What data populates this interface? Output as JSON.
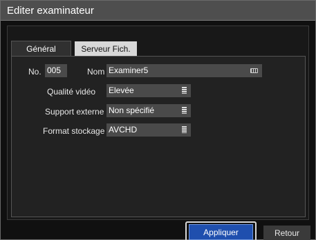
{
  "window": {
    "title": "Editer examinateur"
  },
  "tabs": {
    "general": "Général",
    "server": "Serveur Fich."
  },
  "fields": {
    "no_label": "No.",
    "no_value": "005",
    "name_label": "Nom",
    "name_value": "Examiner5",
    "video_quality_label": "Qualité vidéo",
    "video_quality_value": "Elevée",
    "external_support_label": "Support externe",
    "external_support_value": "Non spécifié",
    "storage_format_label": "Format stockage",
    "storage_format_value": "AVCHD"
  },
  "buttons": {
    "apply": "Appliquer",
    "back": "Retour"
  },
  "icons": {
    "keyboard": "keyboard-icon",
    "dropdown": "list-icon"
  },
  "colors": {
    "accent": "#1f4fae",
    "field_bg": "#4a4a4a",
    "titlebar": "#4e4e4e"
  }
}
